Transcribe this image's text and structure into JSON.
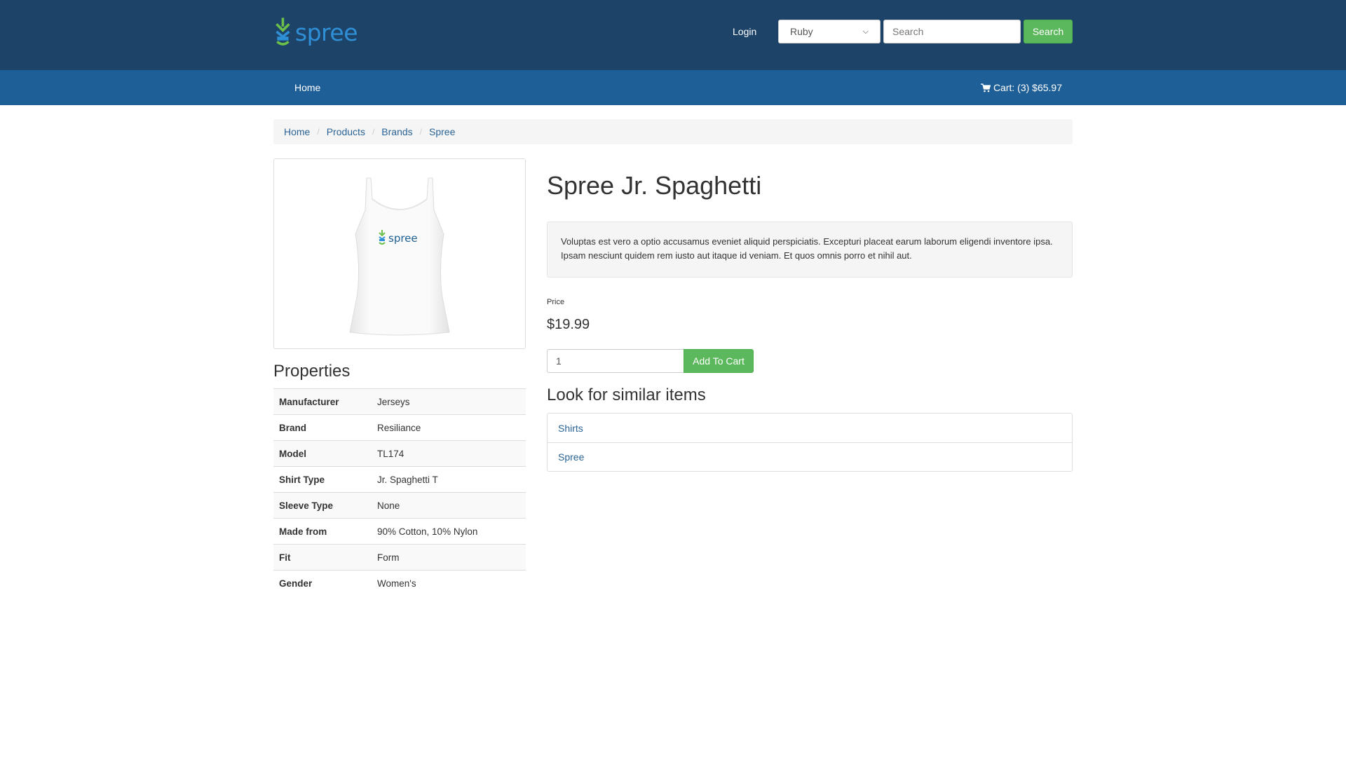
{
  "header": {
    "logo_text": "spree",
    "login_label": "Login",
    "currency_selected": "Ruby",
    "search_placeholder": "Search",
    "search_button": "Search",
    "colors": {
      "header_bg": "#1d4468",
      "nav_bg": "#1f5f97",
      "accent_green": "#5cb85c",
      "link": "#2a6496"
    }
  },
  "nav": {
    "home_label": "Home",
    "cart_label": "Cart: (3) $65.97"
  },
  "breadcrumb": [
    "Home",
    "Products",
    "Brands",
    "Spree"
  ],
  "product": {
    "title": "Spree Jr. Spaghetti",
    "description": "Voluptas est vero a optio accusamus eveniet aliquid perspiciatis. Excepturi placeat earum laborum eligendi inventore ipsa. Ipsam nesciunt quidem rem iusto aut itaque id veniam. Et quos omnis porro et nihil aut.",
    "price_label": "Price",
    "price": "$19.99",
    "quantity": "1",
    "add_to_cart_label": "Add To Cart",
    "image_logo_text": "spree"
  },
  "properties": {
    "title": "Properties",
    "rows": [
      {
        "key": "Manufacturer",
        "value": "Jerseys"
      },
      {
        "key": "Brand",
        "value": "Resiliance"
      },
      {
        "key": "Model",
        "value": "TL174"
      },
      {
        "key": "Shirt Type",
        "value": "Jr. Spaghetti T"
      },
      {
        "key": "Sleeve Type",
        "value": "None"
      },
      {
        "key": "Made from",
        "value": "90% Cotton, 10% Nylon"
      },
      {
        "key": "Fit",
        "value": "Form"
      },
      {
        "key": "Gender",
        "value": "Women's"
      }
    ]
  },
  "similar": {
    "title": "Look for similar items",
    "items": [
      "Shirts",
      "Spree"
    ]
  }
}
